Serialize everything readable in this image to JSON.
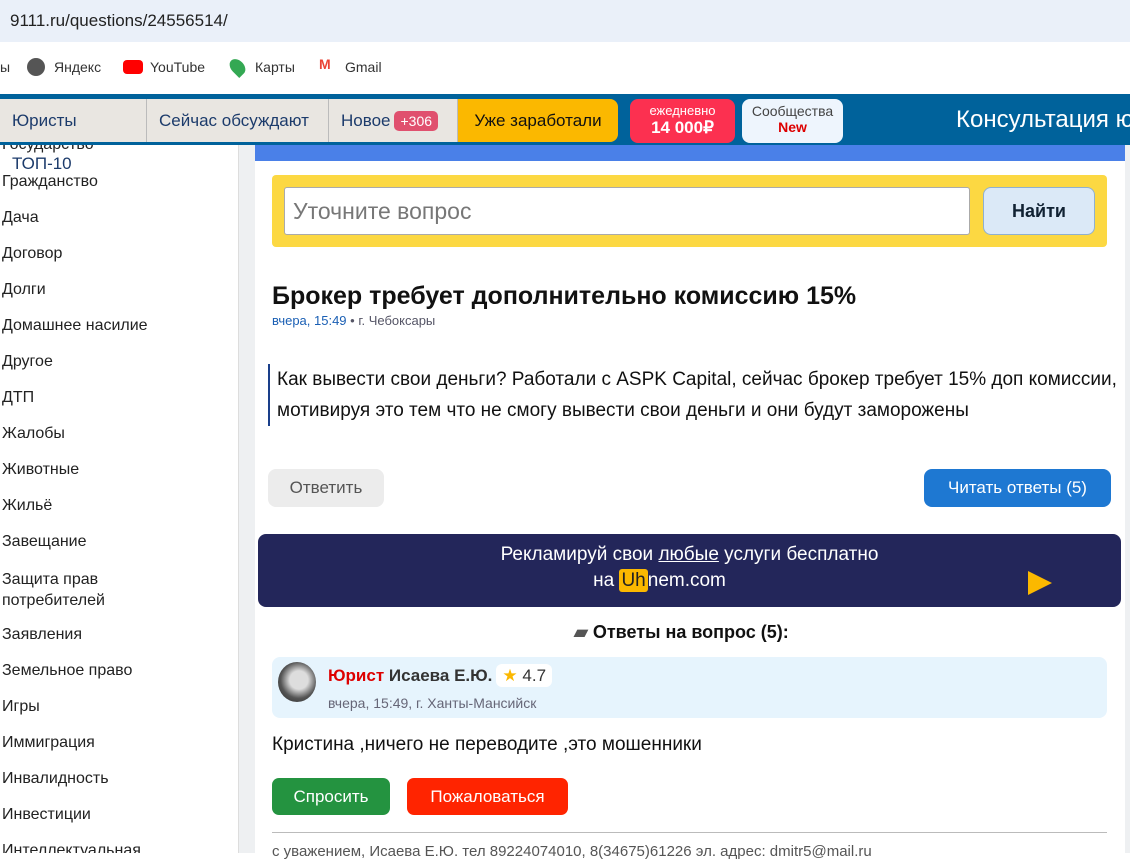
{
  "browser": {
    "url": "9111.ru/questions/24556514/",
    "bookmarks": [
      "ы",
      "Яндекс",
      "YouTube",
      "Карты",
      "Gmail"
    ]
  },
  "nav": {
    "top10": "Юристы ТОП-10",
    "discussed": "Сейчас обсуждают",
    "new_label": "Новое",
    "new_count": "+306",
    "earned": "Уже заработали",
    "daily_label": "ежедневно",
    "daily_amount": "14 000₽",
    "communities": "Сообщества",
    "communities_badge": "New",
    "consult": "Консультация ю"
  },
  "sidebar": [
    "Государство",
    "Гражданство",
    "Дача",
    "Договор",
    "Долги",
    "Домашнее насилие",
    "Другое",
    "ДТП",
    "Жалобы",
    "Животные",
    "Жильё",
    "Завещание",
    "Защита прав потребителей",
    "Заявления",
    "Земельное право",
    "Игры",
    "Иммиграция",
    "Инвалидность",
    "Инвестиции",
    "Интеллектуальная"
  ],
  "search": {
    "placeholder": "Уточните вопрос",
    "button": "Найти"
  },
  "question": {
    "title": "Брокер требует дополнительно комиссию 15%",
    "date": "вчера, 15:49",
    "city": "• г. Чебоксары",
    "text": "Как вывести свои деньги? Работали с ASPK Capital, сейчас брокер требует 15% доп комиссии, мотивируя это тем что не смогу вывести свои деньги и они будут заморожены",
    "reply": "Ответить",
    "read": "Читать ответы (5)"
  },
  "ad": {
    "line1a": "Рекламируй свои ",
    "line1b": "любые",
    "line1c": " услуги бесплатно",
    "line2a": "на ",
    "uh": "Uh",
    "line2b": "nem.com"
  },
  "answers": {
    "heading": "Ответы на вопрос (5):",
    "role": "Юрист",
    "name": "Исаева Е.Ю.",
    "rating": "4.7",
    "meta": "вчера, 15:49,  г. Ханты-Мансийск",
    "text": "Кристина ,ничего не переводите ,это мошенники",
    "ask": "Спросить",
    "complain": "Пожаловаться",
    "signature": "с уважением, Исаева Е.Ю. тел 89224074010, 8(34675)61226 эл. адрес: dmitr5@mail.ru"
  }
}
